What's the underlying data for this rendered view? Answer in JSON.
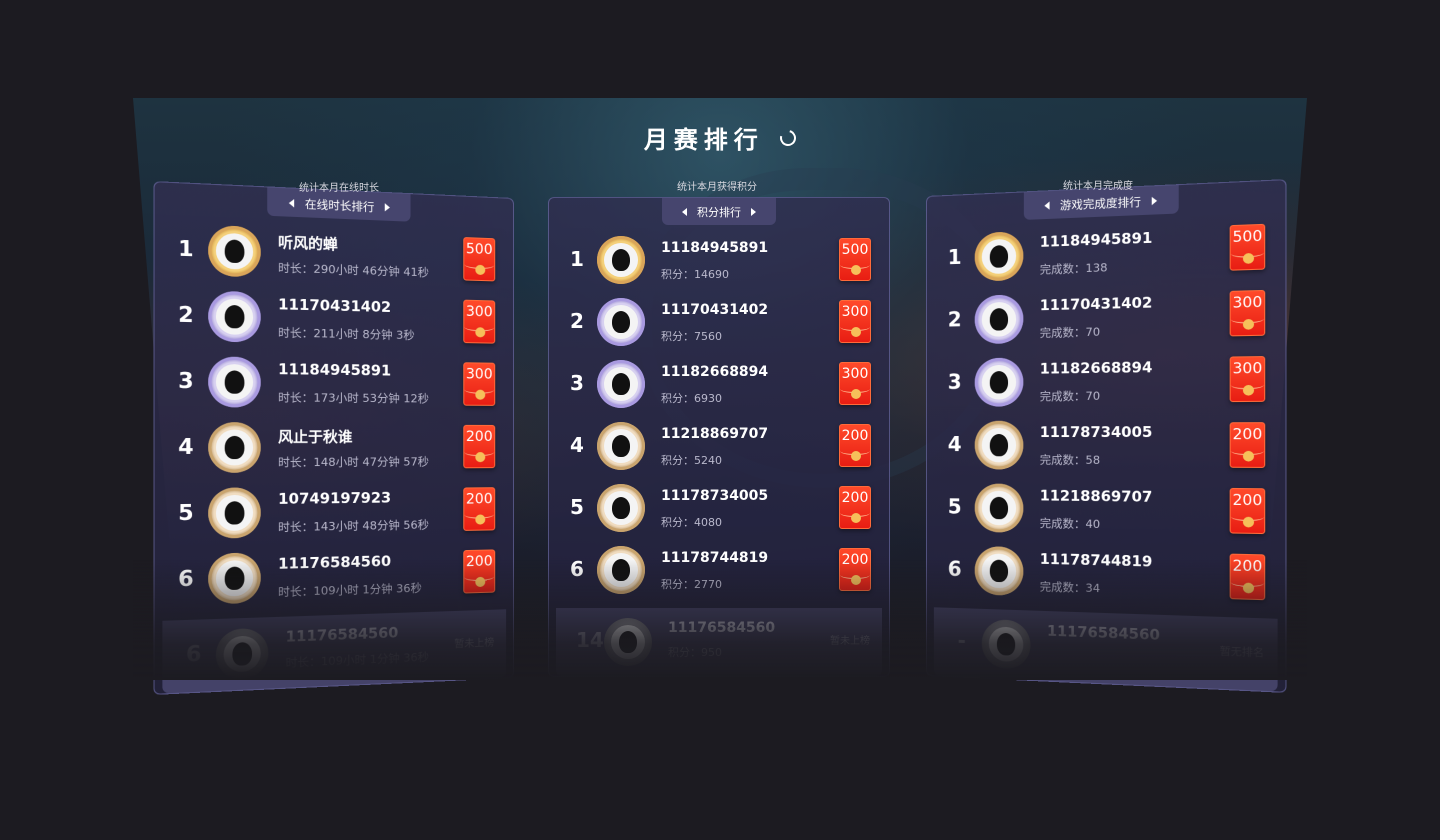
{
  "title": "月赛排行",
  "panels": [
    {
      "caption": "统计本月在线时长",
      "tab_label": "在线时长排行",
      "rows": [
        {
          "rank": "1",
          "name": "听风的蝉",
          "stat": "时长：290小时 46分钟 41秒",
          "reward": "500",
          "badge": "gold"
        },
        {
          "rank": "2",
          "name": "11170431402",
          "stat": "时长：211小时 8分钟 3秒",
          "reward": "300",
          "badge": "silver"
        },
        {
          "rank": "3",
          "name": "11184945891",
          "stat": "时长：173小时 53分钟 12秒",
          "reward": "300",
          "badge": "silver"
        },
        {
          "rank": "4",
          "name": "风止于秋谁",
          "stat": "时长：148小时 47分钟 57秒",
          "reward": "200",
          "badge": "bronze"
        },
        {
          "rank": "5",
          "name": "10749197923",
          "stat": "时长：143小时 48分钟 56秒",
          "reward": "200",
          "badge": "bronze"
        },
        {
          "rank": "6",
          "name": "11176584560",
          "stat": "时长：109小时 1分钟 36秒",
          "reward": "200",
          "badge": "bronze"
        }
      ],
      "mine": {
        "rank": "6",
        "name": "11176584560",
        "stat": "时长：109小时 1分钟 36秒",
        "status": "暂未上榜"
      }
    },
    {
      "caption": "统计本月获得积分",
      "tab_label": "积分排行",
      "rows": [
        {
          "rank": "1",
          "name": "11184945891",
          "stat": "积分：14690",
          "reward": "500",
          "badge": "gold"
        },
        {
          "rank": "2",
          "name": "11170431402",
          "stat": "积分：7560",
          "reward": "300",
          "badge": "silver"
        },
        {
          "rank": "3",
          "name": "11182668894",
          "stat": "积分：6930",
          "reward": "300",
          "badge": "silver"
        },
        {
          "rank": "4",
          "name": "11218869707",
          "stat": "积分：5240",
          "reward": "200",
          "badge": "bronze"
        },
        {
          "rank": "5",
          "name": "11178734005",
          "stat": "积分：4080",
          "reward": "200",
          "badge": "bronze"
        },
        {
          "rank": "6",
          "name": "11178744819",
          "stat": "积分：2770",
          "reward": "200",
          "badge": "bronze"
        }
      ],
      "mine": {
        "rank": "14",
        "name": "11176584560",
        "stat": "积分：950",
        "status": "暂未上榜"
      }
    },
    {
      "caption": "统计本月完成度",
      "tab_label": "游戏完成度排行",
      "rows": [
        {
          "rank": "1",
          "name": "11184945891",
          "stat": "完成数：138",
          "reward": "500",
          "badge": "gold"
        },
        {
          "rank": "2",
          "name": "11170431402",
          "stat": "完成数：70",
          "reward": "300",
          "badge": "silver"
        },
        {
          "rank": "3",
          "name": "11182668894",
          "stat": "完成数：70",
          "reward": "300",
          "badge": "silver"
        },
        {
          "rank": "4",
          "name": "11178734005",
          "stat": "完成数：58",
          "reward": "200",
          "badge": "bronze"
        },
        {
          "rank": "5",
          "name": "11218869707",
          "stat": "完成数：40",
          "reward": "200",
          "badge": "bronze"
        },
        {
          "rank": "6",
          "name": "11178744819",
          "stat": "完成数：34",
          "reward": "200",
          "badge": "bronze"
        }
      ],
      "mine": {
        "rank": "-",
        "name": "11176584560",
        "stat": "",
        "status": "暂无排名"
      }
    }
  ],
  "icons": {
    "refresh": "refresh-icon",
    "prev": "caret-left-icon",
    "next": "caret-right-icon",
    "reward": "red-packet-icon",
    "avatar": "alien-avatar-icon"
  },
  "colors": {
    "background": "#1c1b21",
    "panel": "#302e50",
    "tab": "#46456e",
    "reward": "#e81d13",
    "coin": "#f6c05a"
  }
}
